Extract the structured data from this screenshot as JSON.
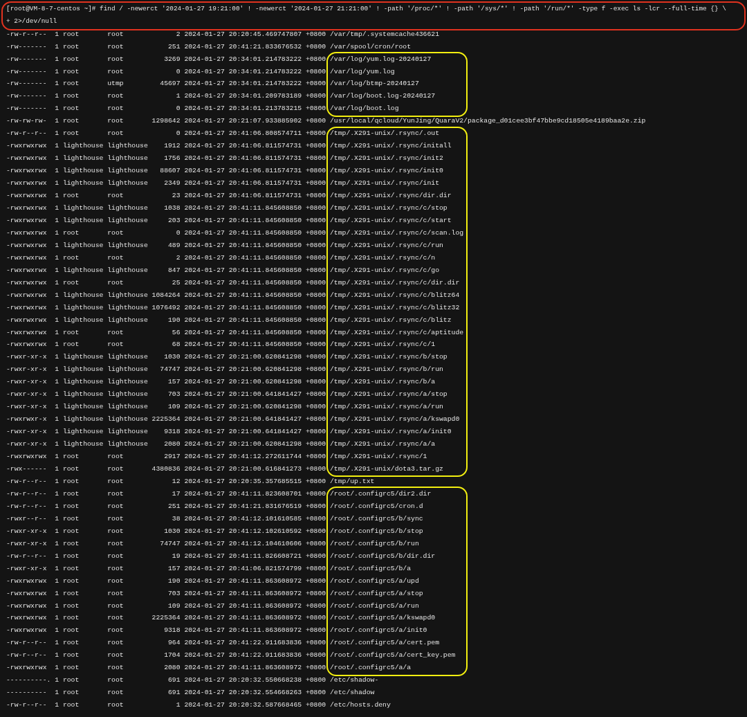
{
  "terminal": {
    "command_circled": true,
    "command_lines": [
      "[root@VM-8-7-centos ~]# find / -newerct '2024-01-27 19:21:00' ! -newerct '2024-01-27 21:21:00' ! -path '/proc/*' ! -path '/sys/*' ! -path '/run/*' -type f -exec ls -lcr --full-time {} \\",
      "+ 2>/dev/null"
    ],
    "blocks": [
      {
        "circled": false,
        "rows": [
          {
            "perms": "-rw-r--r--",
            "links": "1",
            "owner": "root",
            "group": "root",
            "size": "2",
            "date": "2024-01-27",
            "time": "20:20:45.469747807",
            "tz": "+0800",
            "path": "/var/tmp/.systemcache436621"
          },
          {
            "perms": "-rw-------",
            "links": "1",
            "owner": "root",
            "group": "root",
            "size": "251",
            "date": "2024-01-27",
            "time": "20:41:21.833676532",
            "tz": "+0800",
            "path": "/var/spool/cron/root"
          }
        ]
      },
      {
        "circled": true,
        "rows": [
          {
            "perms": "-rw-------",
            "links": "1",
            "owner": "root",
            "group": "root",
            "size": "3269",
            "date": "2024-01-27",
            "time": "20:34:01.214783222",
            "tz": "+0800",
            "path": "/var/log/yum.log-20240127"
          },
          {
            "perms": "-rw-------",
            "links": "1",
            "owner": "root",
            "group": "root",
            "size": "0",
            "date": "2024-01-27",
            "time": "20:34:01.214783222",
            "tz": "+0800",
            "path": "/var/log/yum.log"
          },
          {
            "perms": "-rw-------",
            "links": "1",
            "owner": "root",
            "group": "utmp",
            "size": "45697",
            "date": "2024-01-27",
            "time": "20:34:01.214783222",
            "tz": "+0800",
            "path": "/var/log/btmp-20240127"
          },
          {
            "perms": "-rw-------",
            "links": "1",
            "owner": "root",
            "group": "root",
            "size": "1",
            "date": "2024-01-27",
            "time": "20:34:01.209783189",
            "tz": "+0800",
            "path": "/var/log/boot.log-20240127"
          },
          {
            "perms": "-rw-------",
            "links": "1",
            "owner": "root",
            "group": "root",
            "size": "0",
            "date": "2024-01-27",
            "time": "20:34:01.213783215",
            "tz": "+0800",
            "path": "/var/log/boot.log"
          }
        ]
      },
      {
        "circled": false,
        "rows": [
          {
            "perms": "-rw-rw-rw-",
            "links": "1",
            "owner": "root",
            "group": "root",
            "size": "1298642",
            "date": "2024-01-27",
            "time": "20:21:07.933885902",
            "tz": "+0800",
            "path": "/usr/local/qcloud/YunJing/QuaraV2/package_d01cee3bf47bbe9cd18505e4189baa2e.zip"
          }
        ]
      },
      {
        "circled": true,
        "rows": [
          {
            "perms": "-rw-r--r--",
            "links": "1",
            "owner": "root",
            "group": "root",
            "size": "0",
            "date": "2024-01-27",
            "time": "20:41:06.808574711",
            "tz": "+0800",
            "path": "/tmp/.X291-unix/.rsync/.out"
          },
          {
            "perms": "-rwxrwxrwx",
            "links": "1",
            "owner": "lighthouse",
            "group": "lighthouse",
            "size": "1912",
            "date": "2024-01-27",
            "time": "20:41:06.811574731",
            "tz": "+0800",
            "path": "/tmp/.X291-unix/.rsync/initall"
          },
          {
            "perms": "-rwxrwxrwx",
            "links": "1",
            "owner": "lighthouse",
            "group": "lighthouse",
            "size": "1756",
            "date": "2024-01-27",
            "time": "20:41:06.811574731",
            "tz": "+0800",
            "path": "/tmp/.X291-unix/.rsync/init2"
          },
          {
            "perms": "-rwxrwxrwx",
            "links": "1",
            "owner": "lighthouse",
            "group": "lighthouse",
            "size": "88607",
            "date": "2024-01-27",
            "time": "20:41:06.811574731",
            "tz": "+0800",
            "path": "/tmp/.X291-unix/.rsync/init0"
          },
          {
            "perms": "-rwxrwxrwx",
            "links": "1",
            "owner": "lighthouse",
            "group": "lighthouse",
            "size": "2349",
            "date": "2024-01-27",
            "time": "20:41:06.811574731",
            "tz": "+0800",
            "path": "/tmp/.X291-unix/.rsync/init"
          },
          {
            "perms": "-rwxrwxrwx",
            "links": "1",
            "owner": "root",
            "group": "root",
            "size": "23",
            "date": "2024-01-27",
            "time": "20:41:06.811574731",
            "tz": "+0800",
            "path": "/tmp/.X291-unix/.rsync/dir.dir"
          },
          {
            "perms": "-rwxrwxrwx",
            "links": "1",
            "owner": "lighthouse",
            "group": "lighthouse",
            "size": "1038",
            "date": "2024-01-27",
            "time": "20:41:11.845608850",
            "tz": "+0800",
            "path": "/tmp/.X291-unix/.rsync/c/stop"
          },
          {
            "perms": "-rwxrwxrwx",
            "links": "1",
            "owner": "lighthouse",
            "group": "lighthouse",
            "size": "203",
            "date": "2024-01-27",
            "time": "20:41:11.845608850",
            "tz": "+0800",
            "path": "/tmp/.X291-unix/.rsync/c/start"
          },
          {
            "perms": "-rwxrwxrwx",
            "links": "1",
            "owner": "root",
            "group": "root",
            "size": "0",
            "date": "2024-01-27",
            "time": "20:41:11.845608850",
            "tz": "+0800",
            "path": "/tmp/.X291-unix/.rsync/c/scan.log"
          },
          {
            "perms": "-rwxrwxrwx",
            "links": "1",
            "owner": "lighthouse",
            "group": "lighthouse",
            "size": "489",
            "date": "2024-01-27",
            "time": "20:41:11.845608850",
            "tz": "+0800",
            "path": "/tmp/.X291-unix/.rsync/c/run"
          },
          {
            "perms": "-rwxrwxrwx",
            "links": "1",
            "owner": "root",
            "group": "root",
            "size": "2",
            "date": "2024-01-27",
            "time": "20:41:11.845608850",
            "tz": "+0800",
            "path": "/tmp/.X291-unix/.rsync/c/n"
          },
          {
            "perms": "-rwxrwxrwx",
            "links": "1",
            "owner": "lighthouse",
            "group": "lighthouse",
            "size": "847",
            "date": "2024-01-27",
            "time": "20:41:11.845608850",
            "tz": "+0800",
            "path": "/tmp/.X291-unix/.rsync/c/go"
          },
          {
            "perms": "-rwxrwxrwx",
            "links": "1",
            "owner": "root",
            "group": "root",
            "size": "25",
            "date": "2024-01-27",
            "time": "20:41:11.845608850",
            "tz": "+0800",
            "path": "/tmp/.X291-unix/.rsync/c/dir.dir"
          },
          {
            "perms": "-rwxrwxrwx",
            "links": "1",
            "owner": "lighthouse",
            "group": "lighthouse",
            "size": "1084264",
            "date": "2024-01-27",
            "time": "20:41:11.845608850",
            "tz": "+0800",
            "path": "/tmp/.X291-unix/.rsync/c/blitz64"
          },
          {
            "perms": "-rwxrwxrwx",
            "links": "1",
            "owner": "lighthouse",
            "group": "lighthouse",
            "size": "1076492",
            "date": "2024-01-27",
            "time": "20:41:11.845608850",
            "tz": "+0800",
            "path": "/tmp/.X291-unix/.rsync/c/blitz32"
          },
          {
            "perms": "-rwxrwxrwx",
            "links": "1",
            "owner": "lighthouse",
            "group": "lighthouse",
            "size": "190",
            "date": "2024-01-27",
            "time": "20:41:11.845608850",
            "tz": "+0800",
            "path": "/tmp/.X291-unix/.rsync/c/blitz"
          },
          {
            "perms": "-rwxrwxrwx",
            "links": "1",
            "owner": "root",
            "group": "root",
            "size": "56",
            "date": "2024-01-27",
            "time": "20:41:11.845608850",
            "tz": "+0800",
            "path": "/tmp/.X291-unix/.rsync/c/aptitude"
          },
          {
            "perms": "-rwxrwxrwx",
            "links": "1",
            "owner": "root",
            "group": "root",
            "size": "68",
            "date": "2024-01-27",
            "time": "20:41:11.845608850",
            "tz": "+0800",
            "path": "/tmp/.X291-unix/.rsync/c/1"
          },
          {
            "perms": "-rwxr-xr-x",
            "links": "1",
            "owner": "lighthouse",
            "group": "lighthouse",
            "size": "1030",
            "date": "2024-01-27",
            "time": "20:21:00.620841298",
            "tz": "+0800",
            "path": "/tmp/.X291-unix/.rsync/b/stop"
          },
          {
            "perms": "-rwxr-xr-x",
            "links": "1",
            "owner": "lighthouse",
            "group": "lighthouse",
            "size": "74747",
            "date": "2024-01-27",
            "time": "20:21:00.620841298",
            "tz": "+0800",
            "path": "/tmp/.X291-unix/.rsync/b/run"
          },
          {
            "perms": "-rwxr-xr-x",
            "links": "1",
            "owner": "lighthouse",
            "group": "lighthouse",
            "size": "157",
            "date": "2024-01-27",
            "time": "20:21:00.620841298",
            "tz": "+0800",
            "path": "/tmp/.X291-unix/.rsync/b/a"
          },
          {
            "perms": "-rwxr-xr-x",
            "links": "1",
            "owner": "lighthouse",
            "group": "lighthouse",
            "size": "703",
            "date": "2024-01-27",
            "time": "20:21:00.641841427",
            "tz": "+0800",
            "path": "/tmp/.X291-unix/.rsync/a/stop"
          },
          {
            "perms": "-rwxr-xr-x",
            "links": "1",
            "owner": "lighthouse",
            "group": "lighthouse",
            "size": "109",
            "date": "2024-01-27",
            "time": "20:21:00.620841298",
            "tz": "+0800",
            "path": "/tmp/.X291-unix/.rsync/a/run"
          },
          {
            "perms": "-rwxrwxr-x",
            "links": "1",
            "owner": "lighthouse",
            "group": "lighthouse",
            "size": "2225364",
            "date": "2024-01-27",
            "time": "20:21:00.641841427",
            "tz": "+0800",
            "path": "/tmp/.X291-unix/.rsync/a/kswapd0"
          },
          {
            "perms": "-rwxr-xr-x",
            "links": "1",
            "owner": "lighthouse",
            "group": "lighthouse",
            "size": "9318",
            "date": "2024-01-27",
            "time": "20:21:00.641841427",
            "tz": "+0800",
            "path": "/tmp/.X291-unix/.rsync/a/init0"
          },
          {
            "perms": "-rwxr-xr-x",
            "links": "1",
            "owner": "lighthouse",
            "group": "lighthouse",
            "size": "2080",
            "date": "2024-01-27",
            "time": "20:21:00.620841298",
            "tz": "+0800",
            "path": "/tmp/.X291-unix/.rsync/a/a"
          },
          {
            "perms": "-rwxrwxrwx",
            "links": "1",
            "owner": "root",
            "group": "root",
            "size": "2917",
            "date": "2024-01-27",
            "time": "20:41:12.272611744",
            "tz": "+0800",
            "path": "/tmp/.X291-unix/.rsync/1"
          },
          {
            "perms": "-rwx------",
            "links": "1",
            "owner": "root",
            "group": "root",
            "size": "4380836",
            "date": "2024-01-27",
            "time": "20:21:00.616841273",
            "tz": "+0800",
            "path": "/tmp/.X291-unix/dota3.tar.gz"
          }
        ]
      },
      {
        "circled": false,
        "rows": [
          {
            "perms": "-rw-r--r--",
            "links": "1",
            "owner": "root",
            "group": "root",
            "size": "12",
            "date": "2024-01-27",
            "time": "20:20:35.357685515",
            "tz": "+0800",
            "path": "/tmp/up.txt"
          }
        ]
      },
      {
        "circled": true,
        "rows": [
          {
            "perms": "-rw-r--r--",
            "links": "1",
            "owner": "root",
            "group": "root",
            "size": "17",
            "date": "2024-01-27",
            "time": "20:41:11.823608701",
            "tz": "+0800",
            "path": "/root/.configrc5/dir2.dir"
          },
          {
            "perms": "-rw-r--r--",
            "links": "1",
            "owner": "root",
            "group": "root",
            "size": "251",
            "date": "2024-01-27",
            "time": "20:41:21.831676519",
            "tz": "+0800",
            "path": "/root/.configrc5/cron.d"
          },
          {
            "perms": "-rwxr--r--",
            "links": "1",
            "owner": "root",
            "group": "root",
            "size": "38",
            "date": "2024-01-27",
            "time": "20:41:12.101610585",
            "tz": "+0800",
            "path": "/root/.configrc5/b/sync"
          },
          {
            "perms": "-rwxr-xr-x",
            "links": "1",
            "owner": "root",
            "group": "root",
            "size": "1030",
            "date": "2024-01-27",
            "time": "20:41:12.102610592",
            "tz": "+0800",
            "path": "/root/.configrc5/b/stop"
          },
          {
            "perms": "-rwxr-xr-x",
            "links": "1",
            "owner": "root",
            "group": "root",
            "size": "74747",
            "date": "2024-01-27",
            "time": "20:41:12.104610606",
            "tz": "+0800",
            "path": "/root/.configrc5/b/run"
          },
          {
            "perms": "-rw-r--r--",
            "links": "1",
            "owner": "root",
            "group": "root",
            "size": "19",
            "date": "2024-01-27",
            "time": "20:41:11.826608721",
            "tz": "+0800",
            "path": "/root/.configrc5/b/dir.dir"
          },
          {
            "perms": "-rwxr-xr-x",
            "links": "1",
            "owner": "root",
            "group": "root",
            "size": "157",
            "date": "2024-01-27",
            "time": "20:41:06.821574799",
            "tz": "+0800",
            "path": "/root/.configrc5/b/a"
          },
          {
            "perms": "-rwxrwxrwx",
            "links": "1",
            "owner": "root",
            "group": "root",
            "size": "190",
            "date": "2024-01-27",
            "time": "20:41:11.863608972",
            "tz": "+0800",
            "path": "/root/.configrc5/a/upd"
          },
          {
            "perms": "-rwxrwxrwx",
            "links": "1",
            "owner": "root",
            "group": "root",
            "size": "703",
            "date": "2024-01-27",
            "time": "20:41:11.863608972",
            "tz": "+0800",
            "path": "/root/.configrc5/a/stop"
          },
          {
            "perms": "-rwxrwxrwx",
            "links": "1",
            "owner": "root",
            "group": "root",
            "size": "109",
            "date": "2024-01-27",
            "time": "20:41:11.863608972",
            "tz": "+0800",
            "path": "/root/.configrc5/a/run"
          },
          {
            "perms": "-rwxrwxrwx",
            "links": "1",
            "owner": "root",
            "group": "root",
            "size": "2225364",
            "date": "2024-01-27",
            "time": "20:41:11.863608972",
            "tz": "+0800",
            "path": "/root/.configrc5/a/kswapd0"
          },
          {
            "perms": "-rwxrwxrwx",
            "links": "1",
            "owner": "root",
            "group": "root",
            "size": "9318",
            "date": "2024-01-27",
            "time": "20:41:11.863608972",
            "tz": "+0800",
            "path": "/root/.configrc5/a/init0"
          },
          {
            "perms": "-rw-r--r--",
            "links": "1",
            "owner": "root",
            "group": "root",
            "size": "964",
            "date": "2024-01-27",
            "time": "20:41:22.911683836",
            "tz": "+0800",
            "path": "/root/.configrc5/a/cert.pem"
          },
          {
            "perms": "-rw-r--r--",
            "links": "1",
            "owner": "root",
            "group": "root",
            "size": "1704",
            "date": "2024-01-27",
            "time": "20:41:22.911683836",
            "tz": "+0800",
            "path": "/root/.configrc5/a/cert_key.pem"
          },
          {
            "perms": "-rwxrwxrwx",
            "links": "1",
            "owner": "root",
            "group": "root",
            "size": "2080",
            "date": "2024-01-27",
            "time": "20:41:11.863608972",
            "tz": "+0800",
            "path": "/root/.configrc5/a/a"
          }
        ]
      },
      {
        "circled": false,
        "rows": [
          {
            "perms": "----------.",
            "links": "1",
            "owner": "root",
            "group": "root",
            "size": "691",
            "date": "2024-01-27",
            "time": "20:20:32.550668238",
            "tz": "+0800",
            "path": "/etc/shadow-"
          },
          {
            "perms": "----------",
            "links": "1",
            "owner": "root",
            "group": "root",
            "size": "691",
            "date": "2024-01-27",
            "time": "20:20:32.554668263",
            "tz": "+0800",
            "path": "/etc/shadow"
          },
          {
            "perms": "-rw-r--r--",
            "links": "1",
            "owner": "root",
            "group": "root",
            "size": "1",
            "date": "2024-01-27",
            "time": "20:20:32.587668465",
            "tz": "+0800",
            "path": "/etc/hosts.deny"
          }
        ]
      }
    ]
  }
}
